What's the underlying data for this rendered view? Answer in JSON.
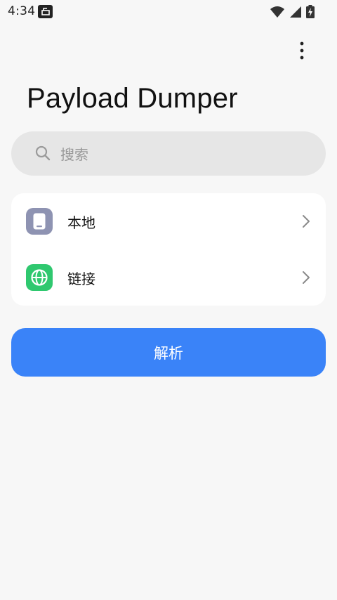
{
  "status_bar": {
    "time": "4:34",
    "icons": [
      "notification-icon",
      "wifi-icon",
      "signal-icon",
      "battery-charging-icon"
    ]
  },
  "toolbar": {
    "menu_icon": "more-vert-icon"
  },
  "page": {
    "title": "Payload Dumper"
  },
  "search": {
    "placeholder": "搜索",
    "value": "",
    "icon": "search-icon"
  },
  "source_list": {
    "items": [
      {
        "label": "本地",
        "icon": "phone-icon",
        "icon_bg": "#8e93b2",
        "chevron": "chevron-right-icon"
      },
      {
        "label": "链接",
        "icon": "globe-icon",
        "icon_bg": "#2fc86f",
        "chevron": "chevron-right-icon"
      }
    ]
  },
  "actions": {
    "parse_label": "解析",
    "parse_color": "#3a83f8"
  }
}
